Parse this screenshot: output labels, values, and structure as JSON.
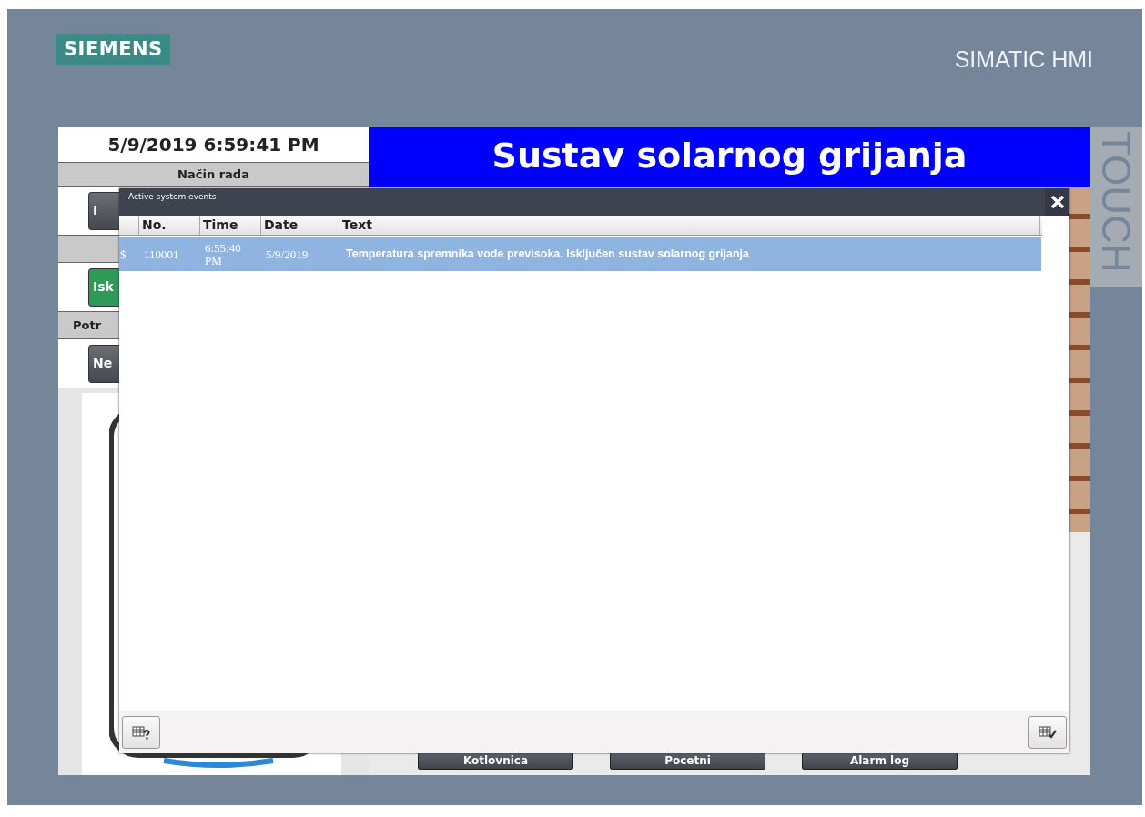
{
  "brand": {
    "logo": "SIEMENS",
    "product": "SIMATIC HMI",
    "side_label": "TOUCH"
  },
  "screen": {
    "datetime": "5/9/2019 6:59:41 PM",
    "mode_label": "Način rada",
    "header": "Sustav solarnog grijanja",
    "left_items": [
      {
        "kind": "dark_button",
        "label": "I"
      },
      {
        "kind": "bar"
      },
      {
        "kind": "green_button",
        "label": "Isk"
      },
      {
        "kind": "bar",
        "label": "Potr"
      },
      {
        "kind": "dark_button",
        "label": "Ne"
      }
    ],
    "nav_buttons": [
      "Kotlovnica",
      "Pocetni",
      "Alarm log"
    ]
  },
  "dialog": {
    "title": "Active system events",
    "columns": [
      "No.",
      "Time",
      "Date",
      "Text"
    ],
    "rows": [
      {
        "status": "$",
        "number": "110001",
        "time": "6:55:40 PM",
        "date": "5/9/2019",
        "text": "Temperatura spremnika vode previsoka. Isključen sustav solarnog grijanja",
        "selected": true
      }
    ]
  }
}
